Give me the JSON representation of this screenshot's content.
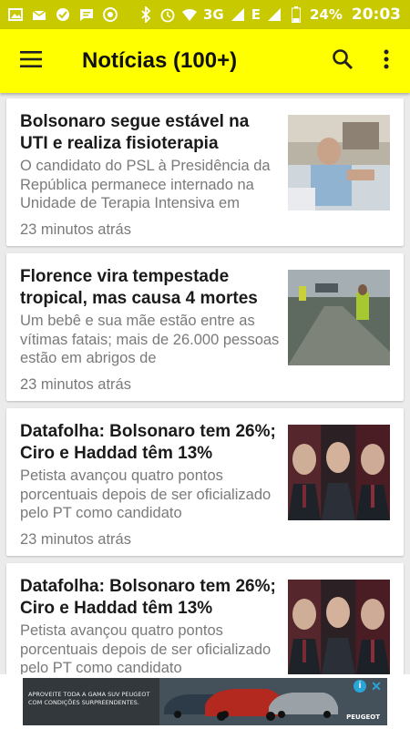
{
  "status_bar": {
    "network_label": "3G",
    "network_label_2": "E",
    "battery_percent": "24%",
    "time": "20:03",
    "colors": {
      "background": "#c9c900"
    }
  },
  "app_bar": {
    "title": "Notícias (100+)",
    "icons": [
      "menu-icon",
      "search-icon",
      "more-vert-icon"
    ],
    "colors": {
      "background": "#ffff00",
      "text": "#111111"
    }
  },
  "articles": [
    {
      "headline": "Bolsonaro segue estável na UTI e realiza fisioterapia",
      "summary": "O candidato do PSL à Presidência da República permanece internado na Unidade de Terapia Intensiva em",
      "time": "23 minutos atrás"
    },
    {
      "headline": "Florence vira tempestade tropical, mas causa 4 mortes",
      "summary": "Um bebê e sua mãe estão entre as vítimas fatais; mais de 26.000 pessoas estão em abrigos de",
      "time": "23 minutos atrás"
    },
    {
      "headline": "Datafolha: Bolsonaro tem 26%; Ciro e Haddad têm 13%",
      "summary": "Petista avançou quatro pontos porcentuais depois de ser oficializado pelo PT como candidato",
      "time": "23 minutos atrás"
    },
    {
      "headline": "Datafolha: Bolsonaro tem 26%; Ciro e Haddad têm 13%",
      "summary": "Petista avançou quatro pontos porcentuais depois de ser oficializado pelo PT como candidato",
      "time": ""
    }
  ],
  "ad": {
    "text": "APROVEITE TODA A GAMA SUV PEUGEOT COM CONDIÇÕES SURPREENDENTES.",
    "brand": "PEUGEOT",
    "info": "i",
    "close": "✕"
  }
}
